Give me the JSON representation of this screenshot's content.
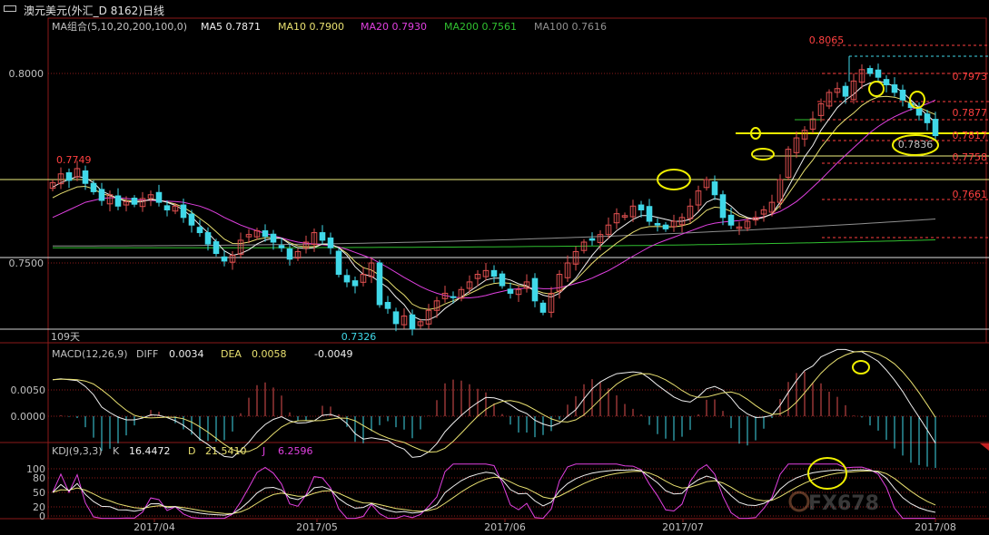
{
  "window": {
    "title": "澳元美元(外汇_D 8162)日线"
  },
  "colors": {
    "up": "#e05050",
    "down": "#40d8e8",
    "ma5": "#f0f0f0",
    "ma10": "#e8e070",
    "ma20": "#e040e0",
    "ma200": "#30c030",
    "ma100": "#909090",
    "grid": "#8b1a1a",
    "text": "#c0c0c0",
    "redLabel": "#ff4040",
    "cyanLabel": "#40d8e8",
    "annotation": "#f0f000",
    "macdUp": "#e05050",
    "macdDown": "#40d8e8"
  },
  "price_panel": {
    "ma_group_label": "MA组合(5,10,20,200,100,0)",
    "ma_labels": [
      {
        "text": "MA5 0.7871",
        "color": "#f0f0f0"
      },
      {
        "text": "MA10 0.7900",
        "color": "#e8e070"
      },
      {
        "text": "MA20 0.7930",
        "color": "#e040e0"
      },
      {
        "text": "MA200 0.7561",
        "color": "#30c030"
      },
      {
        "text": "MA100 0.7616",
        "color": "#909090"
      }
    ],
    "y_ticks": [
      "0.8000",
      "0.7500"
    ],
    "annotations": [
      {
        "text": "0.8065"
      },
      {
        "text": "0.7973"
      },
      {
        "text": "0.7877"
      },
      {
        "text": "0.7817"
      },
      {
        "text": "0.7836"
      },
      {
        "text": "0.7758"
      },
      {
        "text": "0.7661"
      },
      {
        "text": "0.7749"
      },
      {
        "text": "0.7326"
      }
    ],
    "footer_label": "109天"
  },
  "macd_panel": {
    "label": "MACD(12,26,9)",
    "diff_label": "DIFF",
    "diff": "0.0034",
    "dea_label": "DEA",
    "dea": "0.0058",
    "macd": "-0.0049",
    "y_ticks": [
      "0.0050",
      "0.0000"
    ]
  },
  "kdj_panel": {
    "label": "KDJ(9,3,3)",
    "k_label": "K",
    "k": "16.4472",
    "d_label": "D",
    "d": "21.5410",
    "j_label": "J",
    "j": "6.2596",
    "y_ticks": [
      "100",
      "80",
      "50",
      "20",
      "0"
    ]
  },
  "x_axis": {
    "labels": [
      "2017/04",
      "2017/05",
      "2017/06",
      "2017/07",
      "2017/08"
    ]
  },
  "watermark": "FX678",
  "chart_data": {
    "type": "candlestick",
    "title": "澳元美元(外汇_D 8162)日线",
    "price_range": [
      0.7195,
      0.8125
    ],
    "closes": [
      0.7712,
      0.7735,
      0.7718,
      0.7749,
      0.771,
      0.7688,
      0.7665,
      0.768,
      0.765,
      0.7662,
      0.7655,
      0.767,
      0.768,
      0.766,
      0.764,
      0.765,
      0.762,
      0.76,
      0.758,
      0.755,
      0.7525,
      0.7505,
      0.752,
      0.756,
      0.7575,
      0.7585,
      0.757,
      0.7555,
      0.754,
      0.751,
      0.753,
      0.7555,
      0.758,
      0.756,
      0.754,
      0.747,
      0.745,
      0.744,
      0.747,
      0.75,
      0.739,
      0.738,
      0.734,
      0.736,
      0.7326,
      0.7345,
      0.7375,
      0.74,
      0.742,
      0.741,
      0.743,
      0.745,
      0.747,
      0.748,
      0.7465,
      0.744,
      0.742,
      0.743,
      0.745,
      0.74,
      0.737,
      0.742,
      0.747,
      0.75,
      0.753,
      0.7555,
      0.756,
      0.7575,
      0.76,
      0.763,
      0.7625,
      0.765,
      0.764,
      0.761,
      0.76,
      0.759,
      0.761,
      0.762,
      0.765,
      0.769,
      0.772,
      0.768,
      0.762,
      0.76,
      0.7595,
      0.761,
      0.762,
      0.764,
      0.766,
      0.772,
      0.78,
      0.783,
      0.785,
      0.788,
      0.792,
      0.795,
      0.796,
      0.794,
      0.798,
      0.801,
      0.8,
      0.799,
      0.797,
      0.795,
      0.793,
      0.791,
      0.789,
      0.787,
      0.7836
    ],
    "ma5": [
      0.77,
      0.7712,
      0.772,
      0.7728,
      0.7725,
      0.7712,
      0.769,
      0.768,
      0.767,
      0.7662,
      0.766,
      0.7662,
      0.7668,
      0.7666,
      0.766,
      0.7652,
      0.764,
      0.7622,
      0.76,
      0.758,
      0.7556,
      0.7532,
      0.752,
      0.7525,
      0.7535,
      0.755,
      0.756,
      0.7565,
      0.7565,
      0.755,
      0.754,
      0.7538,
      0.754,
      0.755,
      0.755,
      0.754,
      0.752,
      0.749,
      0.747,
      0.7465,
      0.745,
      0.7435,
      0.741,
      0.739,
      0.736,
      0.735,
      0.735,
      0.736,
      0.738,
      0.7395,
      0.741,
      0.7425,
      0.744,
      0.7455,
      0.746,
      0.746,
      0.7455,
      0.7445,
      0.744,
      0.7425,
      0.7415,
      0.741,
      0.742,
      0.744,
      0.746,
      0.749,
      0.752,
      0.7545,
      0.7565,
      0.7585,
      0.76,
      0.7615,
      0.7625,
      0.7625,
      0.762,
      0.7615,
      0.761,
      0.761,
      0.7615,
      0.7635,
      0.766,
      0.767,
      0.7665,
      0.765,
      0.763,
      0.762,
      0.7615,
      0.762,
      0.763,
      0.766,
      0.77,
      0.774,
      0.778,
      0.781,
      0.785,
      0.788,
      0.791,
      0.793,
      0.7945,
      0.7965,
      0.7975,
      0.798,
      0.7975,
      0.7965,
      0.795,
      0.793,
      0.791,
      0.789,
      0.7871
    ],
    "ma20": [
      0.762,
      0.763,
      0.764,
      0.765,
      0.766,
      0.7665,
      0.767,
      0.7672,
      0.7672,
      0.767,
      0.7668,
      0.7666,
      0.7665,
      0.7664,
      0.7663,
      0.7662,
      0.766,
      0.7655,
      0.765,
      0.7642,
      0.7632,
      0.762,
      0.761,
      0.76,
      0.7592,
      0.7585,
      0.7578,
      0.7572,
      0.7566,
      0.756,
      0.7555,
      0.7552,
      0.755,
      0.7548,
      0.7546,
      0.7542,
      0.7536,
      0.7528,
      0.752,
      0.7512,
      0.75,
      0.7488,
      0.7475,
      0.7462,
      0.745,
      0.7438,
      0.7428,
      0.742,
      0.7414,
      0.741,
      0.7408,
      0.7408,
      0.741,
      0.7414,
      0.742,
      0.7425,
      0.743,
      0.7432,
      0.7434,
      0.7434,
      0.7432,
      0.7432,
      0.7435,
      0.744,
      0.7446,
      0.7452,
      0.746,
      0.747,
      0.748,
      0.7492,
      0.7505,
      0.7518,
      0.753,
      0.7542,
      0.7552,
      0.756,
      0.7568,
      0.7576,
      0.7584,
      0.7592,
      0.76,
      0.7605,
      0.7608,
      0.761,
      0.7612,
      0.7615,
      0.7618,
      0.7622,
      0.7628,
      0.7636,
      0.7648,
      0.7662,
      0.768,
      0.77,
      0.772,
      0.7742,
      0.7764,
      0.7784,
      0.7804,
      0.7824,
      0.7844,
      0.786,
      0.7874,
      0.7886,
      0.7896,
      0.7905,
      0.7912,
      0.792,
      0.793
    ],
    "ma200_start": 0.754,
    "ma200_end": 0.7561,
    "ma100_start": 0.7545,
    "ma100_end": 0.7616,
    "key_levels": [
      0.8065,
      0.7973,
      0.7877,
      0.7817,
      0.7758,
      0.7661,
      0.7749,
      0.7326
    ],
    "macd_range": [
      -0.001,
      0.011
    ],
    "kdj_range": [
      0,
      110
    ]
  }
}
